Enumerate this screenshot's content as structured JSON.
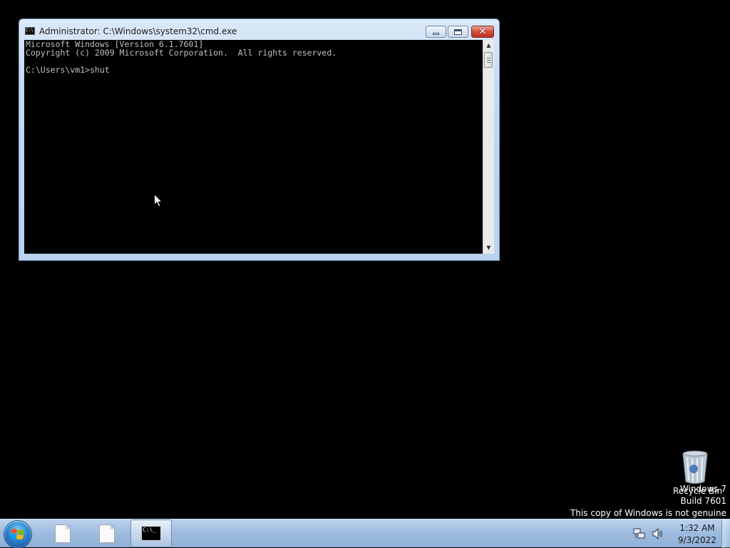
{
  "window": {
    "title": "Administrator: C:\\Windows\\system32\\cmd.exe",
    "icon": "cmd-window-icon",
    "controls": {
      "minimize": "minimize-icon",
      "maximize": "maximize-icon",
      "close": "close-icon"
    }
  },
  "console": {
    "lines": [
      "Microsoft Windows [Version 6.1.7601]",
      "Copyright (c) 2009 Microsoft Corporation.  All rights reserved.",
      "",
      "C:\\Users\\vm1>shut"
    ]
  },
  "desktop": {
    "recycle_bin_label": "Recycle Bin",
    "watermark": {
      "line1": "Windows 7",
      "line2": "Build 7601",
      "line3": "This copy of Windows is not genuine"
    }
  },
  "taskbar": {
    "start_icon": "windows-start-icon",
    "items": [
      {
        "name": "document-icon"
      },
      {
        "name": "document-icon"
      },
      {
        "name": "cmd-taskbar-icon",
        "icon_text": "C:\\_",
        "active": true
      }
    ],
    "tray": {
      "network_icon": "network-icon",
      "volume_icon": "volume-icon",
      "time": "1:32 AM",
      "date": "9/3/2022"
    }
  },
  "colors": {
    "console_text": "#c0c0c0",
    "console_bg": "#000000",
    "close_button": "#c7382a"
  }
}
